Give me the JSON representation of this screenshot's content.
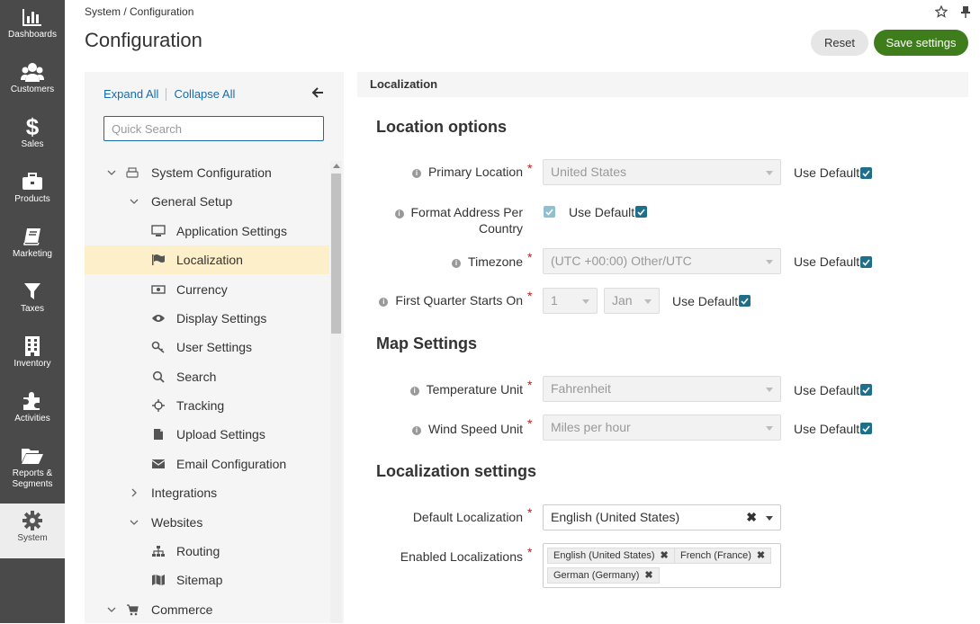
{
  "nav": {
    "items": [
      {
        "label": "Dashboards",
        "icon": "bar-chart-icon"
      },
      {
        "label": "Customers",
        "icon": "users-icon"
      },
      {
        "label": "Sales",
        "icon": "dollar-icon"
      },
      {
        "label": "Products",
        "icon": "briefcase-icon"
      },
      {
        "label": "Marketing",
        "icon": "book-icon"
      },
      {
        "label": "Taxes",
        "icon": "filter-icon"
      },
      {
        "label": "Inventory",
        "icon": "building-icon"
      },
      {
        "label": "Activities",
        "icon": "puzzle-icon"
      },
      {
        "label": "Reports &",
        "label2": "Segments",
        "icon": "folder-open-icon"
      },
      {
        "label": "System",
        "icon": "gear-icon",
        "active": true
      }
    ]
  },
  "header": {
    "breadcrumb": "System / Configuration",
    "title": "Configuration",
    "reset_label": "Reset",
    "save_label": "Save settings"
  },
  "tree": {
    "expand_all": "Expand All",
    "collapse_all": "Collapse All",
    "search_placeholder": "Quick Search",
    "items": [
      {
        "label": "System Configuration",
        "icon": "printer-icon",
        "chevron": "down"
      },
      {
        "label": "General Setup",
        "chevron": "down"
      },
      {
        "label": "Application Settings",
        "icon": "monitor-icon"
      },
      {
        "label": "Localization",
        "icon": "flag-icon",
        "selected": true
      },
      {
        "label": "Currency",
        "icon": "money-icon"
      },
      {
        "label": "Display Settings",
        "icon": "eye-icon"
      },
      {
        "label": "User Settings",
        "icon": "key-icon"
      },
      {
        "label": "Search",
        "icon": "search-icon"
      },
      {
        "label": "Tracking",
        "icon": "crosshairs-icon"
      },
      {
        "label": "Upload Settings",
        "icon": "file-icon"
      },
      {
        "label": "Email Configuration",
        "icon": "envelope-icon"
      },
      {
        "label": "Integrations",
        "chevron": "right"
      },
      {
        "label": "Websites",
        "chevron": "down"
      },
      {
        "label": "Routing",
        "icon": "sitemap-icon"
      },
      {
        "label": "Sitemap",
        "icon": "map-icon"
      },
      {
        "label": "Commerce",
        "icon": "cart-icon",
        "chevron": "down"
      }
    ]
  },
  "main": {
    "section_title": "Localization",
    "location_options": {
      "heading": "Location options",
      "primary_location": {
        "label": "Primary Location",
        "value": "United States"
      },
      "format_address": {
        "label_line1": "Format Address Per",
        "label_line2": "Country"
      },
      "timezone": {
        "label": "Timezone",
        "value": "(UTC +00:00) Other/UTC"
      },
      "first_quarter": {
        "label": "First Quarter Starts On",
        "day": "1",
        "month": "Jan"
      }
    },
    "map_settings": {
      "heading": "Map Settings",
      "temperature_unit": {
        "label": "Temperature Unit",
        "value": "Fahrenheit"
      },
      "wind_speed_unit": {
        "label": "Wind Speed Unit",
        "value": "Miles per hour"
      }
    },
    "localization_settings": {
      "heading": "Localization settings",
      "default_localization": {
        "label": "Default Localization",
        "value": "English (United States)"
      },
      "enabled_localizations": {
        "label": "Enabled Localizations",
        "tags": [
          "English (United States)",
          "French (France)",
          "German (Germany)"
        ]
      }
    },
    "use_default": "Use Default"
  },
  "colors": {
    "nav_bg": "#4a4a4a",
    "accent_link": "#1a6bab",
    "save_green": "#3f7d1c",
    "checkbox": "#1f6f8b",
    "selected_row": "#fcefc9",
    "required": "#c81717"
  }
}
